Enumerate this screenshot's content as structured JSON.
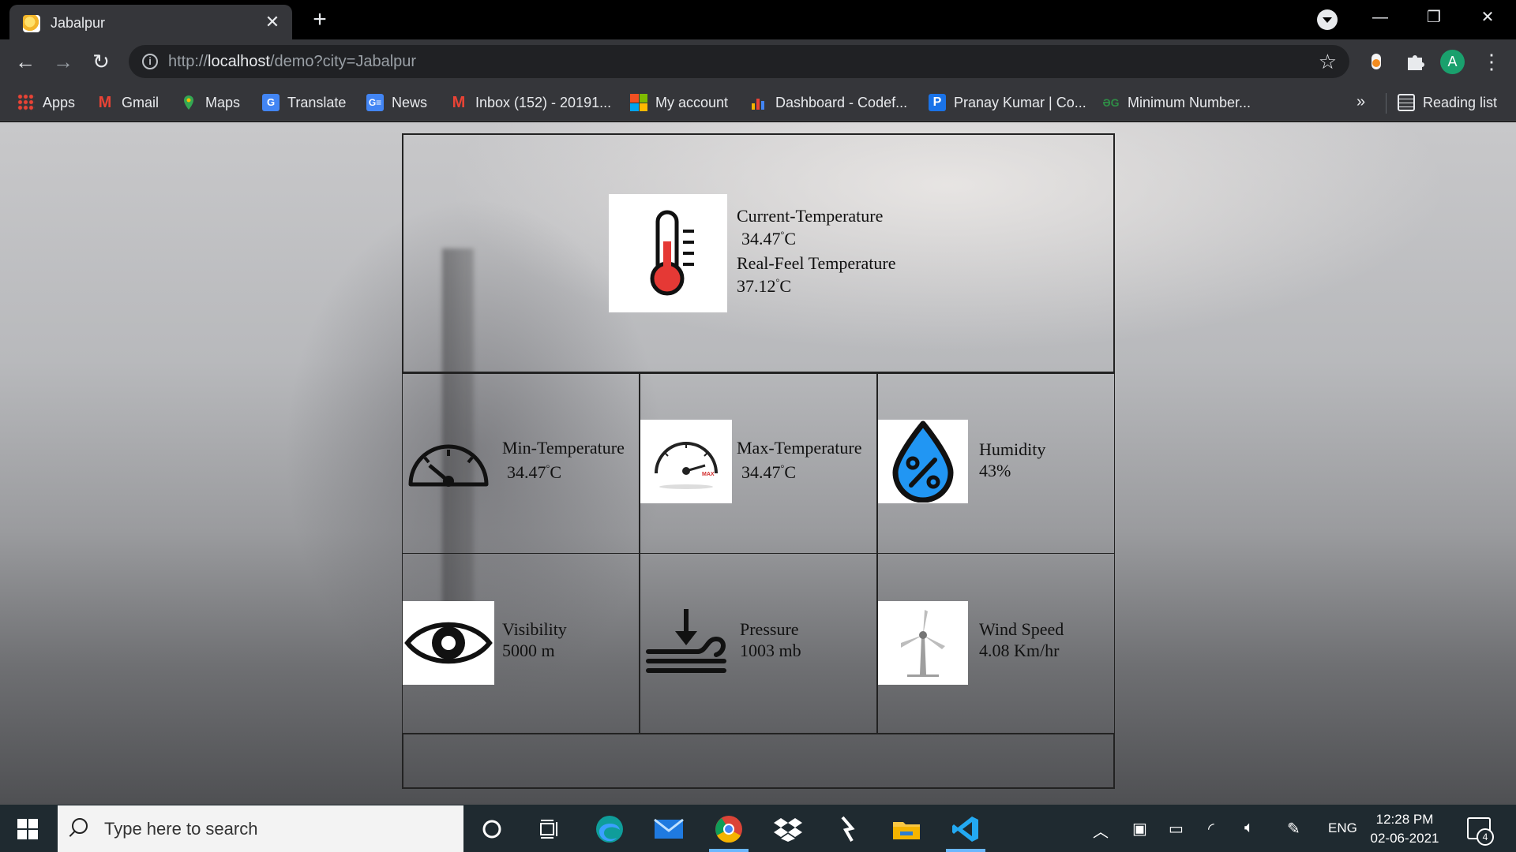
{
  "browser": {
    "tab_title": "Jabalpur",
    "url_prefix": "http://",
    "url_host": "localhost",
    "url_path": "/demo?city=Jabalpur",
    "avatar_letter": "A",
    "bookmarks": [
      {
        "label": "Apps",
        "icon": "apps-grid-icon",
        "color": "#4285f4"
      },
      {
        "label": "Gmail",
        "icon": "gmail-icon",
        "color": "#ea4335"
      },
      {
        "label": "Maps",
        "icon": "maps-pin-icon",
        "color": "#34a853"
      },
      {
        "label": "Translate",
        "icon": "translate-icon",
        "color": "#4285f4"
      },
      {
        "label": "News",
        "icon": "news-icon",
        "color": "#4285f4"
      },
      {
        "label": "Inbox (152) - 20191...",
        "icon": "gmail-icon",
        "color": "#ea4335"
      },
      {
        "label": "My account",
        "icon": "microsoft-icon",
        "color": "#f25022"
      },
      {
        "label": "Dashboard - Codef...",
        "icon": "dashboard-icon",
        "color": "#f4b400"
      },
      {
        "label": "Pranay Kumar | Co...",
        "icon": "p-icon",
        "color": "#1a73e8"
      },
      {
        "label": "Minimum Number...",
        "icon": "gfg-icon",
        "color": "#2f8d46"
      }
    ],
    "bookmarks_more": "»",
    "reading_list": "Reading list"
  },
  "weather": {
    "current_label": "Current-Temperature",
    "current_value": "34.47",
    "realfeel_label": "Real-Feel Temperature",
    "realfeel_value": "37.12",
    "temp_unit": "C",
    "degree_symbol": "°",
    "min_label": "Min-Temperature",
    "min_value": "34.47",
    "max_label": "Max-Temperature",
    "max_value": "34.47",
    "humidity_label": "Humidity",
    "humidity_value": "43%",
    "visibility_label": "Visibility",
    "visibility_value": "5000 m",
    "pressure_label": "Pressure",
    "pressure_value": "1003 mb",
    "wind_label": "Wind Speed",
    "wind_value": "4.08 Km/hr",
    "max_gauge_text": "MAX"
  },
  "taskbar": {
    "search_placeholder": "Type here to search",
    "language": "ENG",
    "time": "12:28 PM",
    "date": "02-06-2021",
    "notification_count": "4"
  }
}
